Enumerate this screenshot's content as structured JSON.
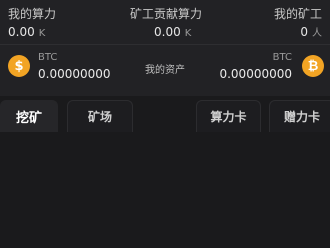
{
  "stats": {
    "my_power": {
      "label": "我的算力",
      "value": "0.00",
      "unit": "K"
    },
    "contribution": {
      "label": "矿工贡献算力",
      "value": "0.00",
      "unit": "K"
    },
    "my_miners": {
      "label": "我的矿工",
      "value": "0",
      "unit": "人"
    }
  },
  "assets": {
    "label": "我的资产",
    "left": {
      "code": "BTC",
      "amount": "0.00000000",
      "icon_text": "$"
    },
    "right": {
      "code": "BTC",
      "amount": "0.00000000",
      "icon_text": "₿"
    }
  },
  "tabs": {
    "mine": "挖矿",
    "farm": "矿场",
    "power_card": "算力卡",
    "gift_card": "赠力卡"
  },
  "colors": {
    "coin": "#f2a424",
    "background": "#1a1a1c",
    "panel": "#222225"
  },
  "icons": {
    "left_coin": "dollar-coin-icon",
    "right_coin": "bitcoin-coin-icon"
  }
}
